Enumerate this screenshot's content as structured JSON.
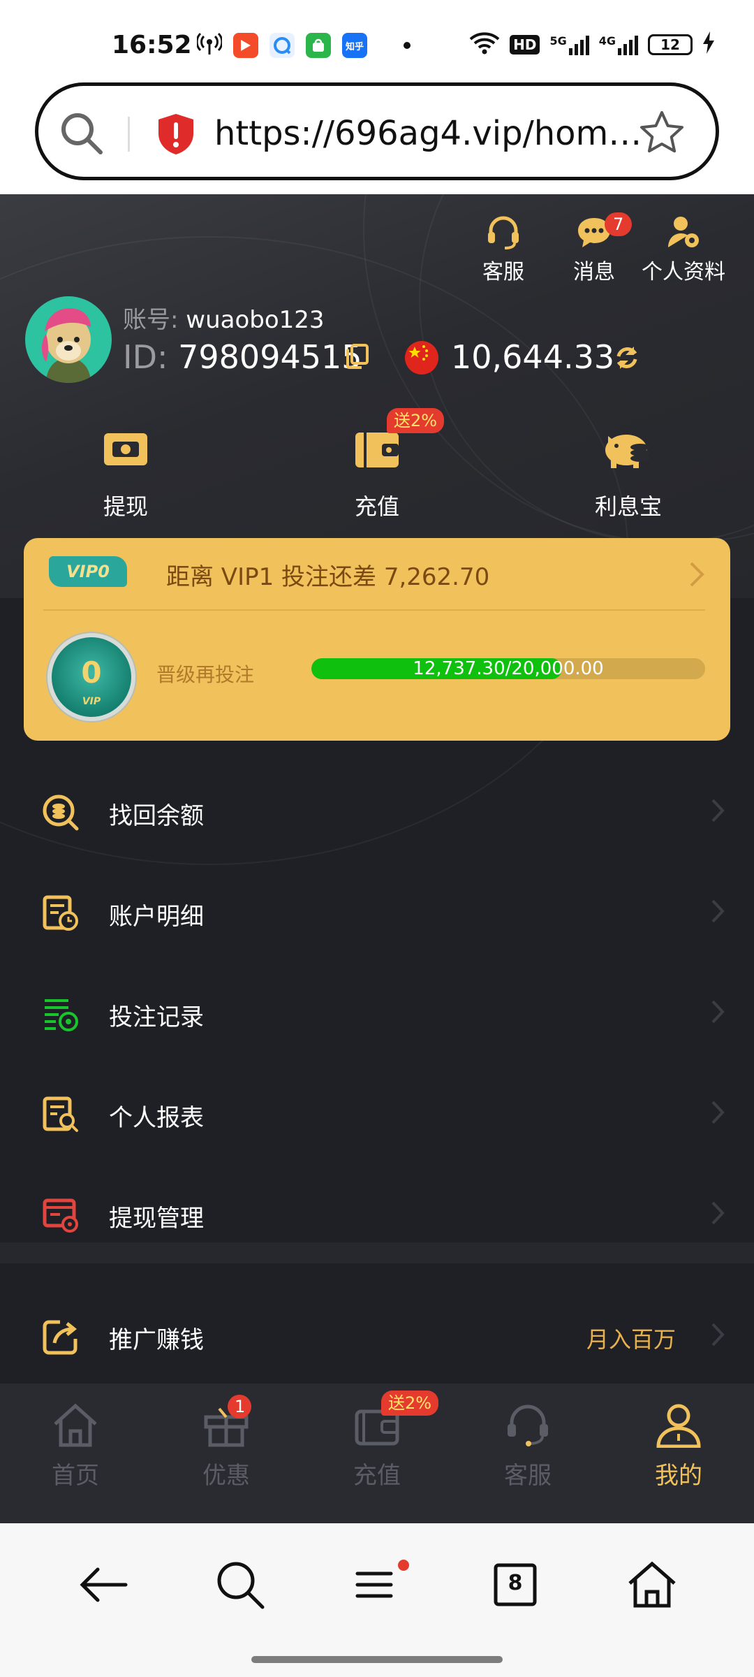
{
  "status_bar": {
    "time": "16:52",
    "apps": [
      {
        "name": "hotspot-icon"
      },
      {
        "name": "video-app-icon",
        "color": "#f44b2a"
      },
      {
        "name": "browser-app-icon",
        "color": "#2a8df4"
      },
      {
        "name": "store-app-icon",
        "color": "#2bb54a"
      },
      {
        "name": "zhihu-app-icon",
        "text": "知乎",
        "color": "#1772f6"
      }
    ],
    "network": [
      "HD",
      "5G",
      "4G"
    ],
    "battery": "12"
  },
  "url_bar": {
    "url": "https://696ag4.vip/home..."
  },
  "header": {
    "top_icons": [
      {
        "label": "客服"
      },
      {
        "label": "消息",
        "badge": "7"
      },
      {
        "label": "个人资料"
      }
    ],
    "account_label": "账号:",
    "account_value": "wuaobo123",
    "id_label": "ID:",
    "id_value": "798094515",
    "balance": "10,644.33",
    "quick_actions": [
      {
        "label": "提现"
      },
      {
        "label": "充值",
        "badge": "送2%"
      },
      {
        "label": "利息宝"
      }
    ]
  },
  "vip": {
    "level_tag": "VIP0",
    "title": "距离  VIP1  投注还差 7,262.70",
    "medal_level": "0",
    "medal_text": "VIP",
    "sub_label": "晋级再投注",
    "progress_text": "12,737.30/20,000.00",
    "progress_fraction": 0.6369
  },
  "menu": [
    {
      "label": "找回余额",
      "icon": "coin-search-icon",
      "color": "#f1c15c"
    },
    {
      "label": "账户明细",
      "icon": "account-detail-icon",
      "color": "#f1c15c"
    },
    {
      "label": "投注记录",
      "icon": "bet-record-icon",
      "color": "#19c52c"
    },
    {
      "label": "个人报表",
      "icon": "report-search-icon",
      "color": "#f1c15c"
    },
    {
      "label": "提现管理",
      "icon": "withdraw-manage-icon",
      "color": "#e2453d"
    }
  ],
  "promo_item": {
    "label": "推广赚钱",
    "extra": "月入百万"
  },
  "tabbar": [
    {
      "label": "首页"
    },
    {
      "label": "优惠",
      "badge": "1"
    },
    {
      "label": "充值",
      "badge": "送2%"
    },
    {
      "label": "客服"
    },
    {
      "label": "我的",
      "active": true
    }
  ],
  "browser_nav": {
    "tabs_count": "8"
  }
}
